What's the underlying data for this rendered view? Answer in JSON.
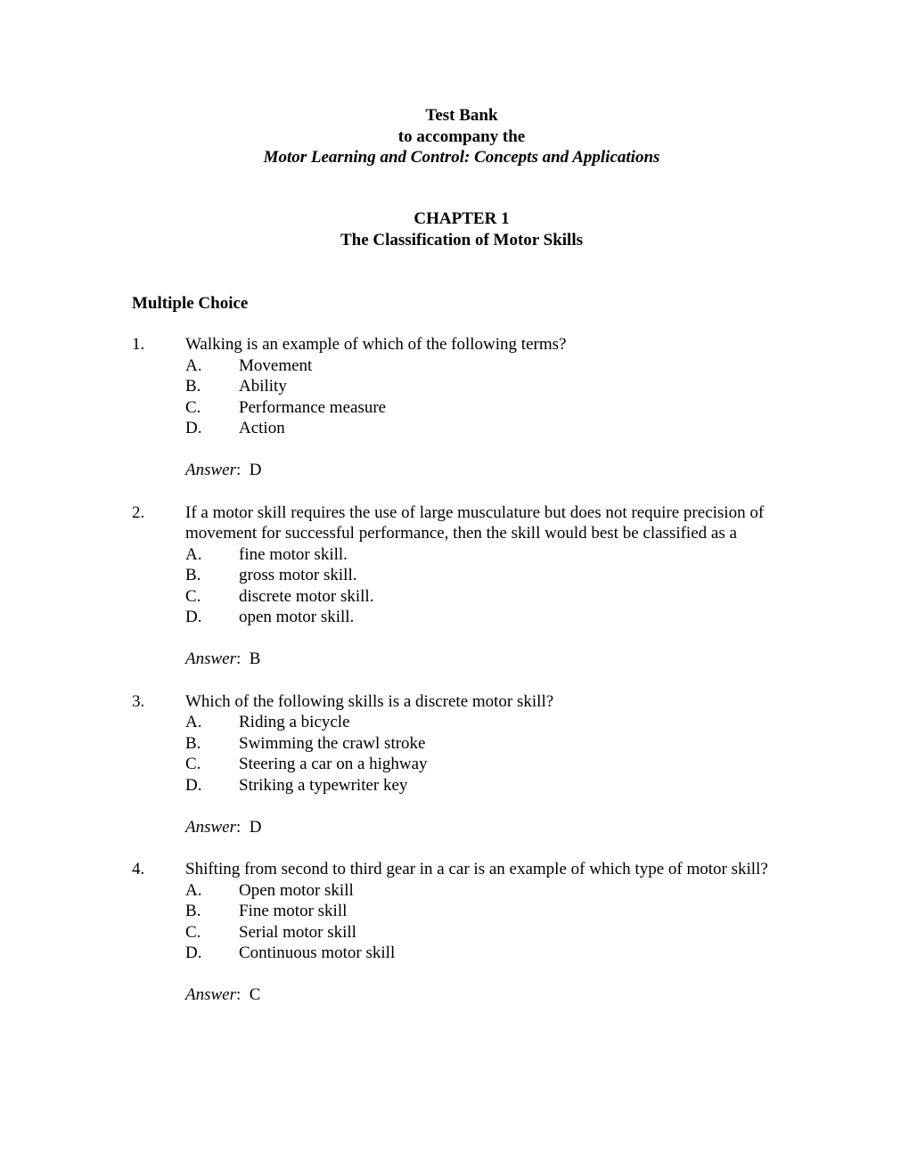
{
  "document": {
    "title_block": {
      "line1": "Test Bank",
      "line2": "to accompany the",
      "line3": "Motor Learning and Control: Concepts and Applications"
    },
    "chapter_block": {
      "chapter_label": "CHAPTER 1",
      "chapter_title": "The Classification of Motor Skills"
    },
    "section_heading": "Multiple Choice",
    "answer_prefix": "Answer",
    "answer_separator": ":",
    "questions": [
      {
        "number": "1.",
        "stem": "Walking is an example of which of the following terms?",
        "options": [
          {
            "letter": "A.",
            "text": "Movement"
          },
          {
            "letter": "B.",
            "text": "Ability"
          },
          {
            "letter": "C.",
            "text": "Performance measure"
          },
          {
            "letter": "D.",
            "text": "Action"
          }
        ],
        "answer": "D"
      },
      {
        "number": "2.",
        "stem": "If a motor skill requires the use of large musculature but does not require precision of movement for successful performance, then the skill would best be classified as a",
        "options": [
          {
            "letter": "A.",
            "text": "fine motor skill."
          },
          {
            "letter": "B.",
            "text": "gross motor skill."
          },
          {
            "letter": "C.",
            "text": "discrete motor skill."
          },
          {
            "letter": "D.",
            "text": "open motor skill."
          }
        ],
        "answer": "B"
      },
      {
        "number": "3.",
        "stem": "Which of the following skills is a discrete motor skill?",
        "options": [
          {
            "letter": "A.",
            "text": "Riding a bicycle"
          },
          {
            "letter": "B.",
            "text": "Swimming the crawl stroke"
          },
          {
            "letter": "C.",
            "text": "Steering a car on a highway"
          },
          {
            "letter": "D.",
            "text": "Striking a typewriter key"
          }
        ],
        "answer": "D"
      },
      {
        "number": "4.",
        "stem": "Shifting from second to third gear in a car is an example of which type of motor skill?",
        "options": [
          {
            "letter": "A.",
            "text": "Open motor skill"
          },
          {
            "letter": "B.",
            "text": "Fine motor skill"
          },
          {
            "letter": "C.",
            "text": "Serial motor skill"
          },
          {
            "letter": "D.",
            "text": "Continuous motor skill"
          }
        ],
        "answer": "C"
      }
    ]
  }
}
